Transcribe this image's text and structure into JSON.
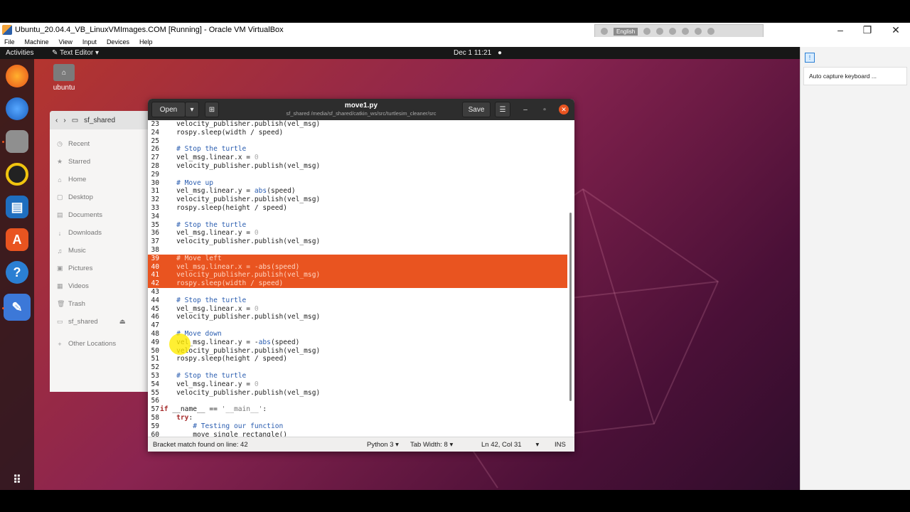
{
  "vbox": {
    "title": "Ubuntu_20.04.4_VB_LinuxVMImages.COM [Running] - Oracle VM VirtualBox",
    "menu": [
      "File",
      "Machine",
      "View",
      "Input",
      "Devices",
      "Help"
    ],
    "toolbar_language": "English",
    "side_notice": "Auto capture keyboard ..."
  },
  "ubuntu": {
    "activities": "Activities",
    "app_menu": "Text Editor",
    "clock": "Dec 1  11:21",
    "desktop_home_label": "ubuntu"
  },
  "files": {
    "header_folder": "sf_shared",
    "sidebar": [
      "Recent",
      "Starred",
      "Home",
      "Desktop",
      "Documents",
      "Downloads",
      "Music",
      "Pictures",
      "Videos",
      "Trash",
      "sf_shared",
      "Other Locations"
    ]
  },
  "gedit": {
    "open_label": "Open",
    "save_label": "Save",
    "title": "move1.py",
    "subtitle": "sf_shared /media/sf_shared/catkin_ws/src/turtlesim_cleaner/src",
    "status_message": "Bracket match found on line: 42",
    "language": "Python 3",
    "tab_width": "Tab Width: 8",
    "cursor_pos": "Ln 42, Col 31",
    "insert_mode": "INS"
  },
  "code_lines": [
    {
      "n": "23",
      "t": "    velocity_publisher.publish(vel_msg)"
    },
    {
      "n": "24",
      "t": "    rospy.sleep(width / speed)"
    },
    {
      "n": "25",
      "t": ""
    },
    {
      "n": "26",
      "t": "    # Stop the turtle"
    },
    {
      "n": "27",
      "t": "    vel_msg.linear.x = 0"
    },
    {
      "n": "28",
      "t": "    velocity_publisher.publish(vel_msg)"
    },
    {
      "n": "29",
      "t": ""
    },
    {
      "n": "30",
      "t": "    # Move up"
    },
    {
      "n": "31",
      "t": "    vel_msg.linear.y = abs(speed)"
    },
    {
      "n": "32",
      "t": "    velocity_publisher.publish(vel_msg)"
    },
    {
      "n": "33",
      "t": "    rospy.sleep(height / speed)"
    },
    {
      "n": "34",
      "t": ""
    },
    {
      "n": "35",
      "t": "    # Stop the turtle"
    },
    {
      "n": "36",
      "t": "    vel_msg.linear.y = 0"
    },
    {
      "n": "37",
      "t": "    velocity_publisher.publish(vel_msg)"
    },
    {
      "n": "38",
      "t": ""
    },
    {
      "n": "39",
      "t": "    # Move left"
    },
    {
      "n": "40",
      "t": "    vel_msg.linear.x = -abs(speed)"
    },
    {
      "n": "41",
      "t": "    velocity_publisher.publish(vel_msg)"
    },
    {
      "n": "42",
      "t": "    rospy.sleep(width / speed)"
    },
    {
      "n": "43",
      "t": ""
    },
    {
      "n": "44",
      "t": "    # Stop the turtle"
    },
    {
      "n": "45",
      "t": "    vel_msg.linear.x = 0"
    },
    {
      "n": "46",
      "t": "    velocity_publisher.publish(vel_msg)"
    },
    {
      "n": "47",
      "t": ""
    },
    {
      "n": "48",
      "t": "    # Move down"
    },
    {
      "n": "49",
      "t": "    vel_msg.linear.y = -abs(speed)"
    },
    {
      "n": "50",
      "t": "    velocity_publisher.publish(vel_msg)"
    },
    {
      "n": "51",
      "t": "    rospy.sleep(height / speed)"
    },
    {
      "n": "52",
      "t": ""
    },
    {
      "n": "53",
      "t": "    # Stop the turtle"
    },
    {
      "n": "54",
      "t": "    vel_msg.linear.y = 0"
    },
    {
      "n": "55",
      "t": "    velocity_publisher.publish(vel_msg)"
    },
    {
      "n": "56",
      "t": ""
    },
    {
      "n": "57",
      "t": "if __name__ == '__main__':"
    },
    {
      "n": "58",
      "t": "    try:"
    },
    {
      "n": "59",
      "t": "        # Testing our function"
    },
    {
      "n": "60",
      "t": "        move_single_rectangle()"
    }
  ],
  "selected_lines": [
    "39",
    "40",
    "41",
    "42"
  ],
  "current_line": "42",
  "dock_apps": [
    "firefox-icon",
    "thunderbird-icon",
    "files-icon",
    "rhythmbox-icon",
    "writer-icon",
    "software-icon",
    "help-icon",
    "text-editor-icon",
    "app-grid-icon"
  ],
  "colors": {
    "accent": "#e95420",
    "header": "#2d2d2d"
  }
}
